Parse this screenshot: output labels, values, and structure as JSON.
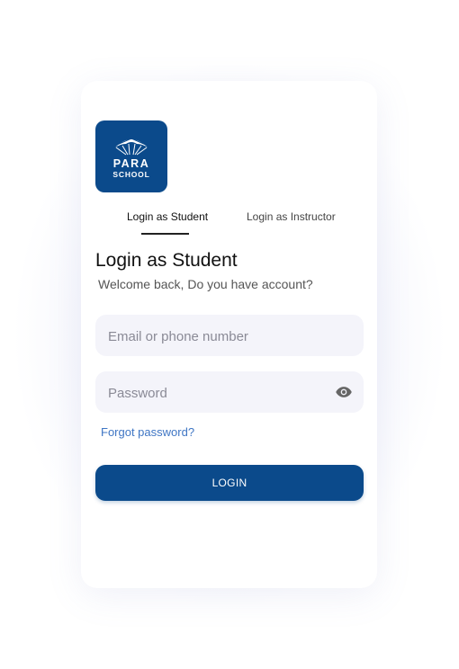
{
  "logo": {
    "line1": "PARA",
    "line2": "SCHOOL",
    "icon": "parachute-icon",
    "background": "#0b4a8b"
  },
  "tabs": [
    {
      "label": "Login as Student",
      "active": true
    },
    {
      "label": "Login as Instructor",
      "active": false
    }
  ],
  "form": {
    "title": "Login as Student",
    "subtitle": "Welcome back, Do you have account?",
    "email_placeholder": "Email or phone number",
    "email_value": "",
    "password_placeholder": "Password",
    "password_value": "",
    "password_toggle_icon": "eye-icon",
    "forgot_label": "Forgot password?",
    "login_label": "LOGIN"
  },
  "colors": {
    "primary": "#0b4a8b",
    "link": "#3f76c4",
    "field_bg": "#f4f4fa"
  }
}
